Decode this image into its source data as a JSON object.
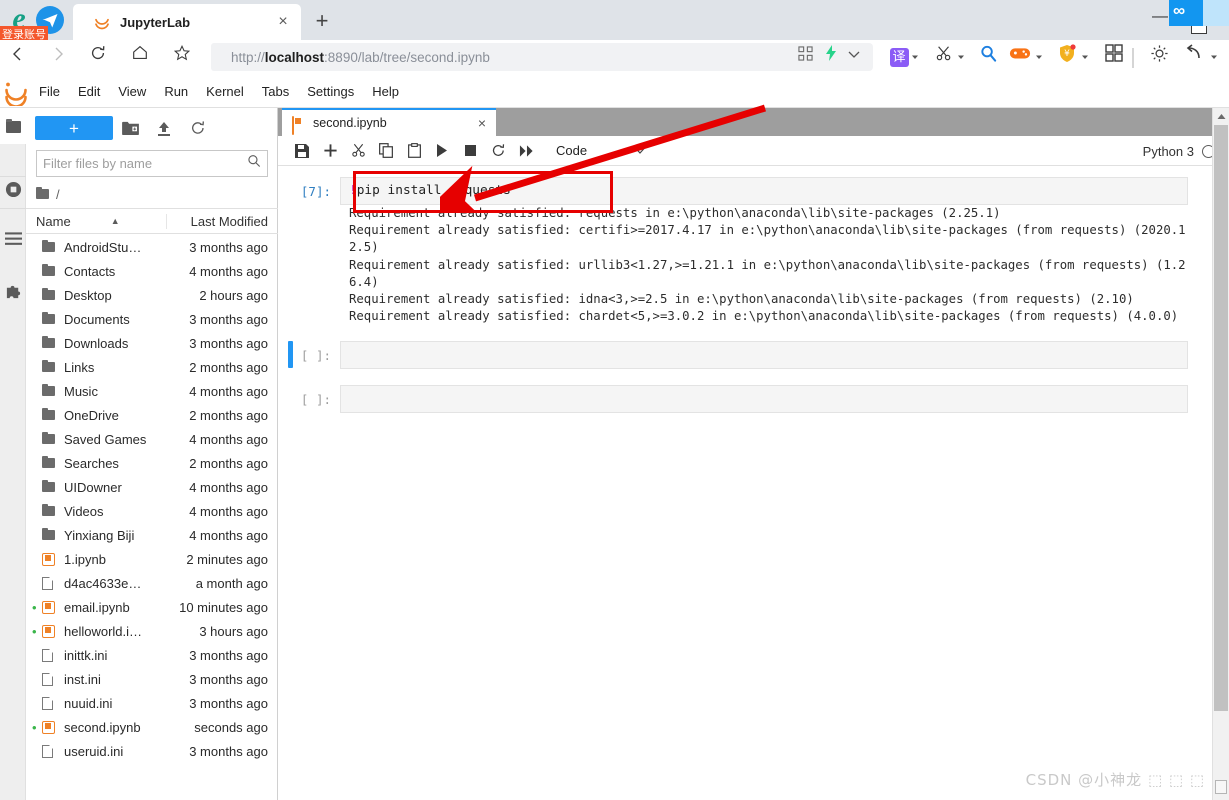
{
  "browser": {
    "tab_title": "JupyterLab",
    "tab_close": "×",
    "new_tab": "+",
    "cn_badge": "登录账号",
    "url_scheme": "http://",
    "url_host": "localhost",
    "url_rest": ":8890/lab/tree/second.ipynb",
    "url_full": "http://localhost:8890/lab/tree/second.ipynb",
    "nav": {
      "back": "‹",
      "forward": "›",
      "reload": "reload-icon",
      "home": "home-icon",
      "favorite": "star-icon"
    },
    "extensions": [
      "qr-grid-icon",
      "lightning-icon",
      "chevron-down-icon",
      "translate-icon",
      "scissors-icon",
      "magnifier-icon",
      "gamepad-icon",
      "shield-icon",
      "apps-grid-icon",
      "brightness-icon",
      "undo-icon"
    ],
    "window": {
      "minimize": "—"
    }
  },
  "jupyter": {
    "menu": [
      "File",
      "Edit",
      "View",
      "Run",
      "Kernel",
      "Tabs",
      "Settings",
      "Help"
    ],
    "rail_icons": [
      "folder-icon",
      "running-terminals-icon",
      "table-of-contents-icon",
      "extension-puzzle-icon"
    ]
  },
  "filebrowser": {
    "new_label": "+",
    "toolbar_icons": [
      "new-folder-icon",
      "upload-icon",
      "refresh-icon"
    ],
    "filter_placeholder": "Filter files by name",
    "filter_value": "",
    "breadcrumb": "/",
    "columns": {
      "name": "Name",
      "modified": "Last Modified",
      "sort": "▲"
    },
    "items": [
      {
        "name": "AndroidStu…",
        "modified": "3 months ago",
        "type": "folder",
        "running": false
      },
      {
        "name": "Contacts",
        "modified": "4 months ago",
        "type": "folder",
        "running": false
      },
      {
        "name": "Desktop",
        "modified": "2 hours ago",
        "type": "folder",
        "running": false
      },
      {
        "name": "Documents",
        "modified": "3 months ago",
        "type": "folder",
        "running": false
      },
      {
        "name": "Downloads",
        "modified": "3 months ago",
        "type": "folder",
        "running": false
      },
      {
        "name": "Links",
        "modified": "2 months ago",
        "type": "folder",
        "running": false
      },
      {
        "name": "Music",
        "modified": "4 months ago",
        "type": "folder",
        "running": false
      },
      {
        "name": "OneDrive",
        "modified": "2 months ago",
        "type": "folder",
        "running": false
      },
      {
        "name": "Saved Games",
        "modified": "4 months ago",
        "type": "folder",
        "running": false
      },
      {
        "name": "Searches",
        "modified": "2 months ago",
        "type": "folder",
        "running": false
      },
      {
        "name": "UIDowner",
        "modified": "4 months ago",
        "type": "folder",
        "running": false
      },
      {
        "name": "Videos",
        "modified": "4 months ago",
        "type": "folder",
        "running": false
      },
      {
        "name": "Yinxiang Biji",
        "modified": "4 months ago",
        "type": "folder",
        "running": false
      },
      {
        "name": "1.ipynb",
        "modified": "2 minutes ago",
        "type": "notebook",
        "running": false
      },
      {
        "name": "d4ac4633e…",
        "modified": "a month ago",
        "type": "file",
        "running": false
      },
      {
        "name": "email.ipynb",
        "modified": "10 minutes ago",
        "type": "notebook",
        "running": true
      },
      {
        "name": "helloworld.i…",
        "modified": "3 hours ago",
        "type": "notebook",
        "running": true
      },
      {
        "name": "inittk.ini",
        "modified": "3 months ago",
        "type": "file",
        "running": false
      },
      {
        "name": "inst.ini",
        "modified": "3 months ago",
        "type": "file",
        "running": false
      },
      {
        "name": "nuuid.ini",
        "modified": "3 months ago",
        "type": "file",
        "running": false
      },
      {
        "name": "second.ipynb",
        "modified": "seconds ago",
        "type": "notebook",
        "running": true
      },
      {
        "name": "useruid.ini",
        "modified": "3 months ago",
        "type": "file",
        "running": false
      }
    ]
  },
  "notebook": {
    "tab_label": "second.ipynb",
    "tab_close": "×",
    "toolbar_icons": [
      "save-icon",
      "insert-cell-icon",
      "cut-icon",
      "copy-icon",
      "paste-icon",
      "run-icon",
      "stop-icon",
      "restart-icon",
      "restart-run-all-icon"
    ],
    "cell_type": "Code",
    "cell_type_caret": "⌄",
    "kernel_name": "Python 3",
    "cells": [
      {
        "prompt": "[7]:",
        "source": "!pip install requests",
        "source_bang": "!",
        "source_rest": "pip install requests",
        "output": "Requirement already satisfied: requests in e:\\python\\anaconda\\lib\\site-packages (2.25.1)\nRequirement already satisfied: certifi>=2017.4.17 in e:\\python\\anaconda\\lib\\site-packages (from requests) (2020.12.5)\nRequirement already satisfied: urllib3<1.27,>=1.21.1 in e:\\python\\anaconda\\lib\\site-packages (from requests) (1.26.4)\nRequirement already satisfied: idna<3,>=2.5 in e:\\python\\anaconda\\lib\\site-packages (from requests) (2.10)\nRequirement already satisfied: chardet<5,>=3.0.2 in e:\\python\\anaconda\\lib\\site-packages (from requests) (4.0.0)"
      },
      {
        "prompt": "[ ]:",
        "source": "",
        "output": "",
        "active": true
      },
      {
        "prompt": "[ ]:",
        "source": "",
        "output": ""
      }
    ]
  },
  "annotations": {
    "highlight_target": "!pip install requests",
    "arrow_color": "#e60000",
    "box_color": "#e60000"
  },
  "watermark": "CSDN @小神龙 ⬚ ⬚ ⬚"
}
